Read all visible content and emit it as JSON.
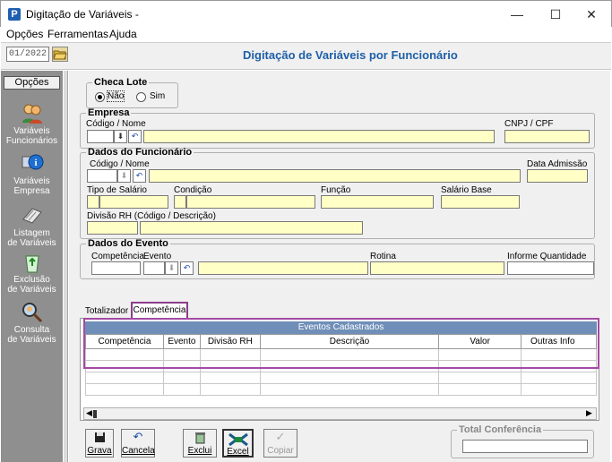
{
  "window": {
    "title": "Digitação de Variáveis -",
    "app_icon": "P",
    "min": "—",
    "max": "☐",
    "close": "✕"
  },
  "menu": [
    "Opções",
    "Ferramentas",
    "Ajuda"
  ],
  "toolbar": {
    "period": "01/2022",
    "page_title": "Digitação de Variáveis por Funcionário"
  },
  "sidebar": {
    "header": "Opções",
    "items": [
      {
        "label1": "Variáveis",
        "label2": "Funcionários",
        "icon": "people-icon"
      },
      {
        "label1": "Variáveis",
        "label2": "Empresa",
        "icon": "info-computer-icon"
      },
      {
        "label1": "Listagem",
        "label2": "de Variáveis",
        "icon": "list-printer-icon"
      },
      {
        "label1": "Exclusão",
        "label2": "de Variáveis",
        "icon": "recycle-bin-icon"
      },
      {
        "label1": "Consulta",
        "label2": "de Variáveis",
        "icon": "magnifier-user-icon"
      }
    ]
  },
  "checa_lote": {
    "title": "Checa Lote",
    "option_nao": "Não",
    "option_sim": "Sim",
    "selected": "Não"
  },
  "empresa": {
    "title": "Empresa",
    "codigo_nome": "Código / Nome",
    "cnpj": "CNPJ / CPF"
  },
  "funcionario": {
    "title": "Dados do Funcionário",
    "codigo_nome": "Código / Nome",
    "data_admissao": "Data Admissão",
    "tipo_salario": "Tipo de Salário",
    "condicao": "Condição",
    "funcao": "Função",
    "salario_base": "Salário Base",
    "divisao_rh": "Divisão RH (Código / Descrição)"
  },
  "evento": {
    "title": "Dados do Evento",
    "competencia": "Competência",
    "evento": "Evento",
    "rotina": "Rotina",
    "informe_quantidade": "Informe Quantidade"
  },
  "tabs": [
    "Totalizador",
    "Competência"
  ],
  "grid": {
    "title": "Eventos Cadastrados",
    "columns": [
      "Competência",
      "Evento",
      "Divisão RH",
      "Descrição",
      "Valor",
      "Outras Info"
    ]
  },
  "buttons": {
    "grava": "Grava",
    "cancela": "Cancela",
    "exclui": "Exclui",
    "excel": "Excel",
    "copiar": "Copiar"
  },
  "total_conferencia": {
    "title": "Total Conferência",
    "value": ""
  },
  "colors": {
    "accent": "#1f5fa8",
    "sidebar": "#8f8f8f",
    "field_yellow": "#ffffc6",
    "highlight": "#a44aa4"
  }
}
